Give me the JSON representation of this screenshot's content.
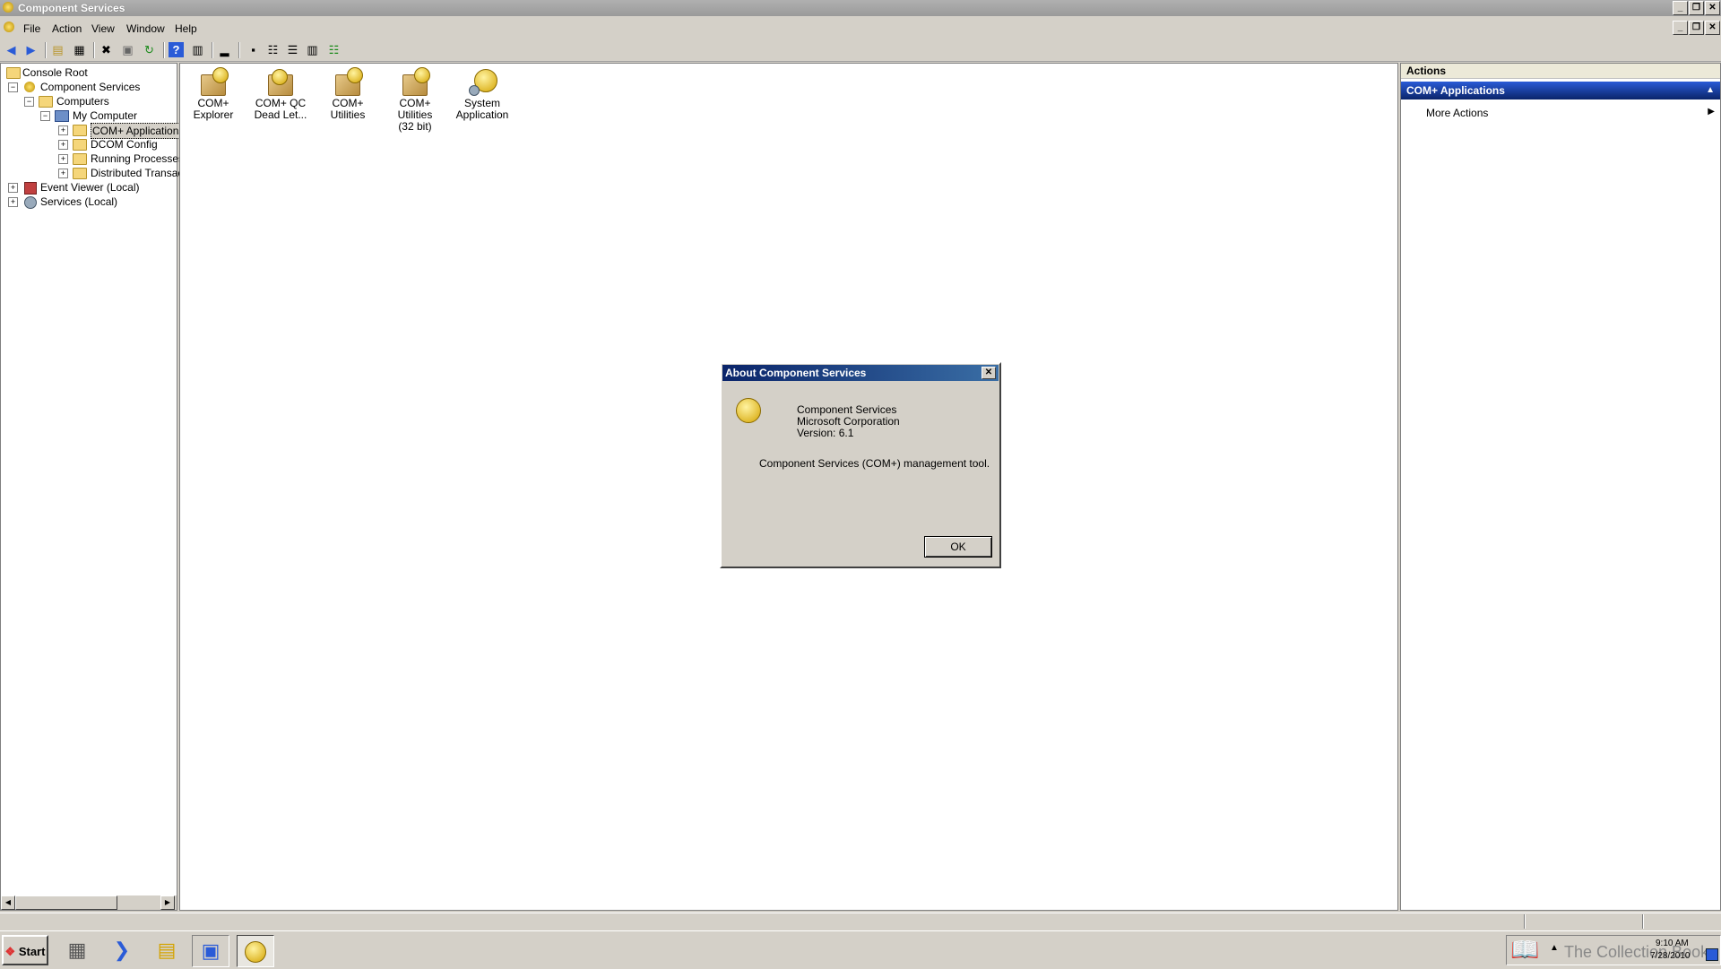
{
  "window": {
    "title": "Component Services",
    "controls": [
      "_",
      "❐",
      "✕"
    ]
  },
  "menu": [
    "File",
    "Action",
    "View",
    "Window",
    "Help"
  ],
  "toolbar_icons": [
    "back-icon",
    "forward-icon",
    "up-folder-icon",
    "show-hide-tree-icon",
    "delete-icon",
    "properties-icon",
    "refresh-icon",
    "help-icon",
    "console-icon",
    "export-icon",
    "large-icons-icon",
    "small-icons-icon",
    "list-icon",
    "detail-icon",
    "view-icon"
  ],
  "tree": {
    "console_root": "Console Root",
    "component_services": "Component Services",
    "computers": "Computers",
    "my_computer": "My Computer",
    "com_applications": "COM+ Applications",
    "dcom_config": "DCOM Config",
    "running_processes": "Running Processes",
    "distributed_transac": "Distributed Transac",
    "event_viewer": "Event Viewer (Local)",
    "services": "Services (Local)"
  },
  "center_icons": [
    {
      "line1": "COM+",
      "line2": "Explorer"
    },
    {
      "line1": "COM+ QC",
      "line2": "Dead Let..."
    },
    {
      "line1": "COM+ Utilities",
      "line2": ""
    },
    {
      "line1": "COM+ Utilities",
      "line2": "(32 bit)"
    },
    {
      "line1": "System",
      "line2": "Application"
    }
  ],
  "actions": {
    "header": "Actions",
    "section": "COM+ Applications",
    "more": "More Actions"
  },
  "dialog": {
    "title": "About Component Services",
    "product": "Component Services",
    "company": "Microsoft Corporation",
    "version": "Version: 6.1",
    "description": "Component Services (COM+) management tool.",
    "ok": "OK"
  },
  "taskbar": {
    "start": "Start",
    "time": "9:10 AM",
    "date": "7/28/2010",
    "watermark": "The Collection Book"
  }
}
